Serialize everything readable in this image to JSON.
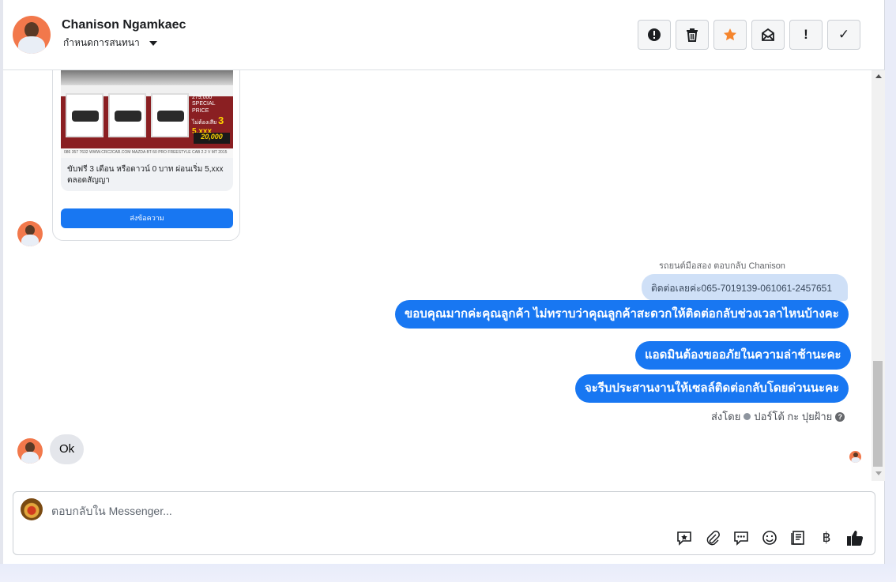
{
  "header": {
    "contact_name": "Chanison Ngamkaec",
    "assign_label": "กำหนดการสนทนา",
    "toolbar": [
      {
        "name": "spam-button",
        "icon": "alert-circle-icon"
      },
      {
        "name": "delete-button",
        "icon": "trash-icon"
      },
      {
        "name": "star-button",
        "icon": "star-icon",
        "color": "#f5852d"
      },
      {
        "name": "mark-unread-button",
        "icon": "envelope-icon"
      },
      {
        "name": "follow-up-button",
        "icon": "exclamation-icon",
        "glyph": "!"
      },
      {
        "name": "done-button",
        "icon": "check-icon",
        "glyph": "✓"
      }
    ]
  },
  "card": {
    "image": {
      "price_small": "279,000 SPECIAL PRICE",
      "free_label": "ไม่ต้องเสีย",
      "months": "3",
      "monthly": "5,xxx",
      "down": "20,000",
      "footer": "086 357 7632 WWW.CRC2CAR.COM   MAZDA BT-50 PRO FREESTYLE CAB 2.2 V MT 2015"
    },
    "text": "ขับฟรี 3 เดือน หรือดาวน์ 0 บาท ผ่อนเริ่ม 5,xxx ตลอดสัญญา",
    "button_label": "ส่งข้อความ"
  },
  "reply_note": "รถยนต์มือสอง ตอบกลับ Chanison",
  "quoted_message": "ติดต่อเลยค่ะ065-7019139-061061-2457651",
  "outgoing_messages": [
    "ขอบคุณมากค่ะคุณลูกค้า ไม่ทราบว่าคุณลูกค้าสะดวกให้ติดต่อกลับช่วงเวลาไหนบ้างคะ",
    "แอดมินต้องขออภัยในความล่าช้านะคะ",
    "จะรีบประสานงานให้เซลล์ติดต่อกลับโดยด่วนนะคะ"
  ],
  "sent_by": {
    "prefix": "ส่งโดย",
    "agent": "ปอร์โต้ กะ ปุยฝ้าย",
    "help_glyph": "?"
  },
  "incoming_message": "Ok",
  "composer": {
    "placeholder": "ตอบกลับใน Messenger...",
    "icons": [
      "saved-reply-icon",
      "attachment-icon",
      "chat-bubble-icon",
      "emoji-icon",
      "catalog-icon",
      "baht-icon",
      "like-icon"
    ],
    "baht_glyph": "฿"
  },
  "colors": {
    "accent": "#1877f2",
    "star": "#f5852d",
    "quoted_bubble": "#cfe0f7"
  }
}
